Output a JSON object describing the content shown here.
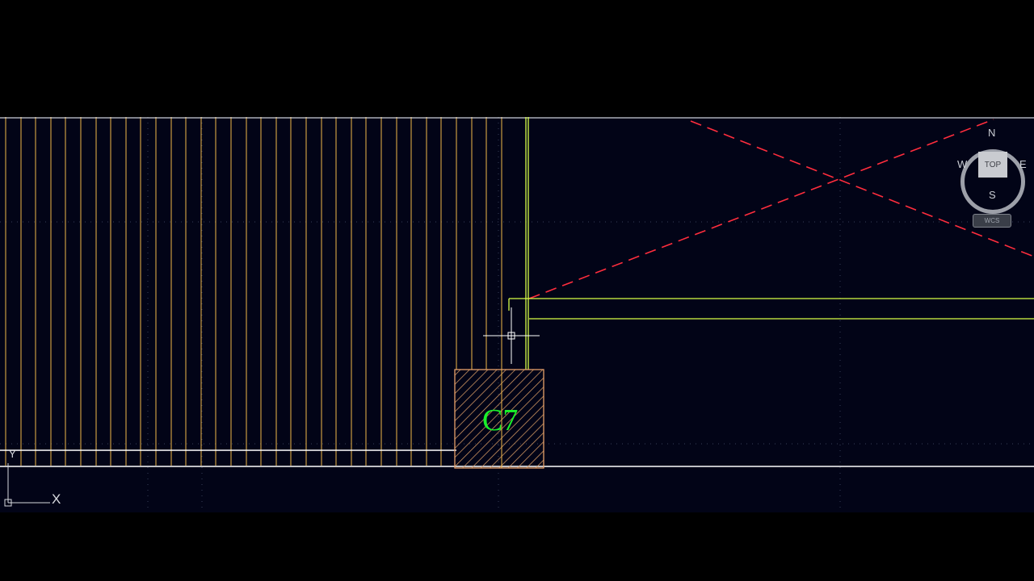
{
  "colors": {
    "background": "#020417",
    "bars": "#f0b84a",
    "beam": "#d8ff46",
    "tag": "#19f02a",
    "centerline": "#ff2d3d",
    "white_line": "#ffffff",
    "hatch": "#e6a06a"
  },
  "viewcube": {
    "north": "N",
    "south": "S",
    "east": "E",
    "west": "W",
    "face_label": "TOP",
    "coordinate_system": "WCS"
  },
  "ucs_icon": {
    "y_label": "Y",
    "x_label": "X"
  },
  "column": {
    "label": "C7"
  },
  "icons": [
    "viewcube-icon",
    "ucs-icon",
    "crosshair-cursor-icon"
  ]
}
